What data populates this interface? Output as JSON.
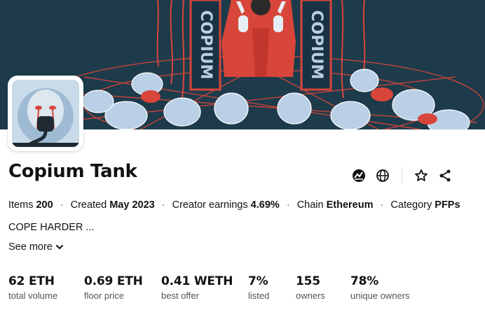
{
  "collection": {
    "name": "Copium Tank",
    "banner_text_left": "COPIUM",
    "banner_text_right": "COPIUM"
  },
  "meta": {
    "items_label": "Items",
    "items_value": "200",
    "created_label": "Created",
    "created_value": "May 2023",
    "earnings_label": "Creator earnings",
    "earnings_value": "4.69%",
    "chain_label": "Chain",
    "chain_value": "Ethereum",
    "category_label": "Category",
    "category_value": "PFPs",
    "separator": "·"
  },
  "description": "COPE HARDER ...",
  "see_more": "See more",
  "stats": [
    {
      "value": "62 ETH",
      "label": "total volume"
    },
    {
      "value": "0.69 ETH",
      "label": "floor price"
    },
    {
      "value": "0.41 WETH",
      "label": "best offer"
    },
    {
      "value": "7%",
      "label": "listed"
    },
    {
      "value": "155",
      "label": "owners"
    },
    {
      "value": "78%",
      "label": "unique owners"
    }
  ],
  "actions": [
    {
      "icon": "activity-chart-icon"
    },
    {
      "icon": "globe-icon"
    },
    {
      "icon": "star-icon"
    },
    {
      "icon": "share-icon"
    }
  ],
  "colors": {
    "banner_bg": "#1c3a4a",
    "banner_red": "#d8453a",
    "figure_blue": "#b9d0e6"
  }
}
